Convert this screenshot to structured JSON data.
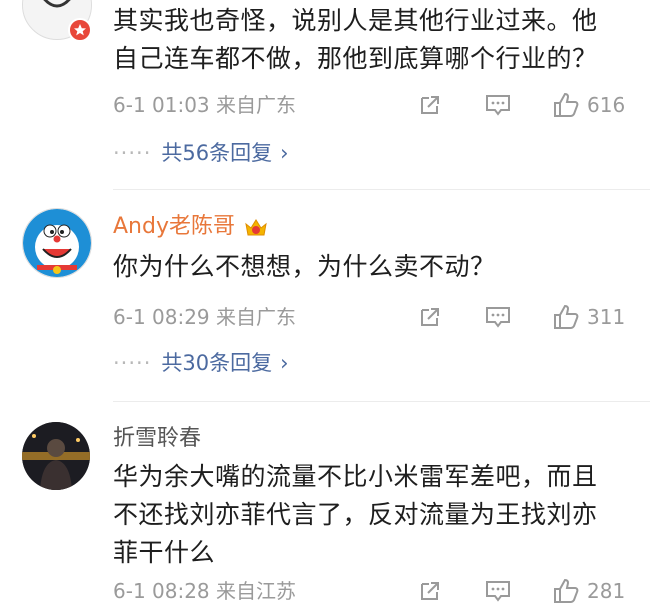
{
  "comments": [
    {
      "text_lines": [
        "其实我也奇怪，说别人是其他行业过来。他",
        "自己连车都不做，那他到底算哪个行业的？"
      ],
      "meta": "6-1 01:03 来自广东",
      "likes": "616",
      "replies": {
        "dots": "·····",
        "label": "共56条回复",
        "chevron": "›"
      }
    },
    {
      "username": "Andy老陈哥",
      "username_color": "#e8773a",
      "text_lines": [
        "你为什么不想想，为什么卖不动？"
      ],
      "meta": "6-1 08:29 来自广东",
      "likes": "311",
      "replies": {
        "dots": "·····",
        "label": "共30条回复",
        "chevron": "›"
      }
    },
    {
      "username": "折雪聆春",
      "username_color": "#555555",
      "text_lines": [
        "华为余大嘴的流量不比小米雷军差吧，而且",
        "不还找刘亦菲代言了，反对流量为王找刘亦",
        "菲干什么"
      ],
      "meta": "6-1 08:28 来自江苏",
      "likes": "281"
    }
  ],
  "icons": {
    "share": "share-icon",
    "comment": "comment-icon",
    "like": "thumbs-up-icon",
    "badge": "vip-crown-icon"
  },
  "colors": {
    "meta": "#9a9a9a",
    "link": "#4c6aa0",
    "username_vip": "#e8773a"
  }
}
